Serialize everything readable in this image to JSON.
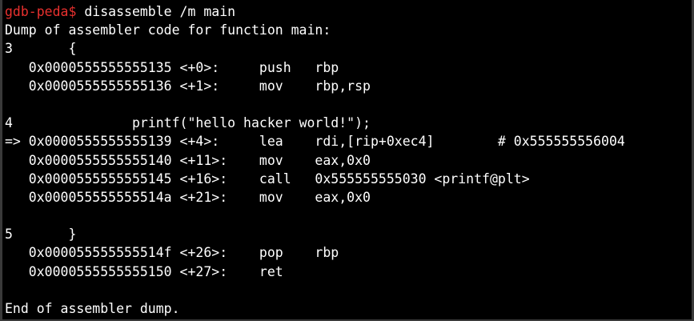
{
  "terminal": {
    "prompt": "gdb-peda$",
    "command": " disassemble /m main",
    "colors": {
      "background": "#000000",
      "text": "#ffffff",
      "prompt": "#e8302e"
    },
    "lines": [
      "Dump of assembler code for function main:",
      "3\t{",
      "   0x0000555555555135 <+0>:\tpush   rbp",
      "   0x0000555555555136 <+1>:\tmov    rbp,rsp",
      "",
      "4\t\tprintf(\"hello hacker world!\");",
      "=> 0x0000555555555139 <+4>:\tlea    rdi,[rip+0xec4]        # 0x555555556004",
      "   0x0000555555555140 <+11>:\tmov    eax,0x0",
      "   0x0000555555555145 <+16>:\tcall   0x555555555030 <printf@plt>",
      "   0x000055555555514a <+21>:\tmov    eax,0x0",
      "",
      "5\t}",
      "   0x000055555555514f <+26>:\tpop    rbp",
      "   0x0000555555555150 <+27>:\tret",
      "",
      "End of assembler dump."
    ]
  }
}
